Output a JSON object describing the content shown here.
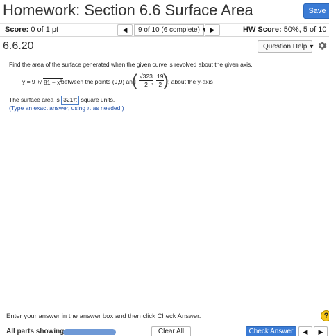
{
  "header": {
    "title": "Homework: Section 6.6 Surface Area",
    "save_label": "Save",
    "accent_color": "#3a7bd5"
  },
  "score_bar": {
    "score_label": "Score:",
    "score_value": "0 of 1 pt",
    "prev_icon": "triangle-left-icon",
    "prev_glyph": "◀",
    "question_selector": "9 of 10 (6 complete)",
    "dropdown_glyph": "▼",
    "next_icon": "triangle-right-icon",
    "next_glyph": "▶",
    "hw_score_label": "HW Score:",
    "hw_score_value": "50%, 5 of 10 pts"
  },
  "question_bar": {
    "question_id": "6.6.20",
    "help_label": "Question Help",
    "help_caret": "▼",
    "settings_icon": "gear-icon"
  },
  "question": {
    "prompt": "Find the area of the surface generated when the given curve is revolved about the given axis.",
    "curve_lhs": "y = 9 +",
    "sqrt_radicand": "81 − x",
    "exponent": "2",
    "between_text": "between the points (9,9) and",
    "paren_open": "(",
    "frac1_num": "√323",
    "frac1_den": "2",
    "comma": ",",
    "frac2_num": "19",
    "frac2_den": "2",
    "paren_close": ")",
    "axis_text": "; about the y-axis",
    "answer_prefix": "The surface area is",
    "answer_value": "321π",
    "answer_suffix": "square units.",
    "hint": "(Type an exact answer, using π as needed.)"
  },
  "instruction": "Enter your answer in the answer box and then click Check Answer.",
  "help_circle_glyph": "?",
  "footer": {
    "all_parts_label": "All parts showing",
    "progress": 1.0,
    "clear_label": "Clear All",
    "check_label": "Check Answer",
    "prev_glyph": "◀",
    "next_glyph": "▶"
  }
}
